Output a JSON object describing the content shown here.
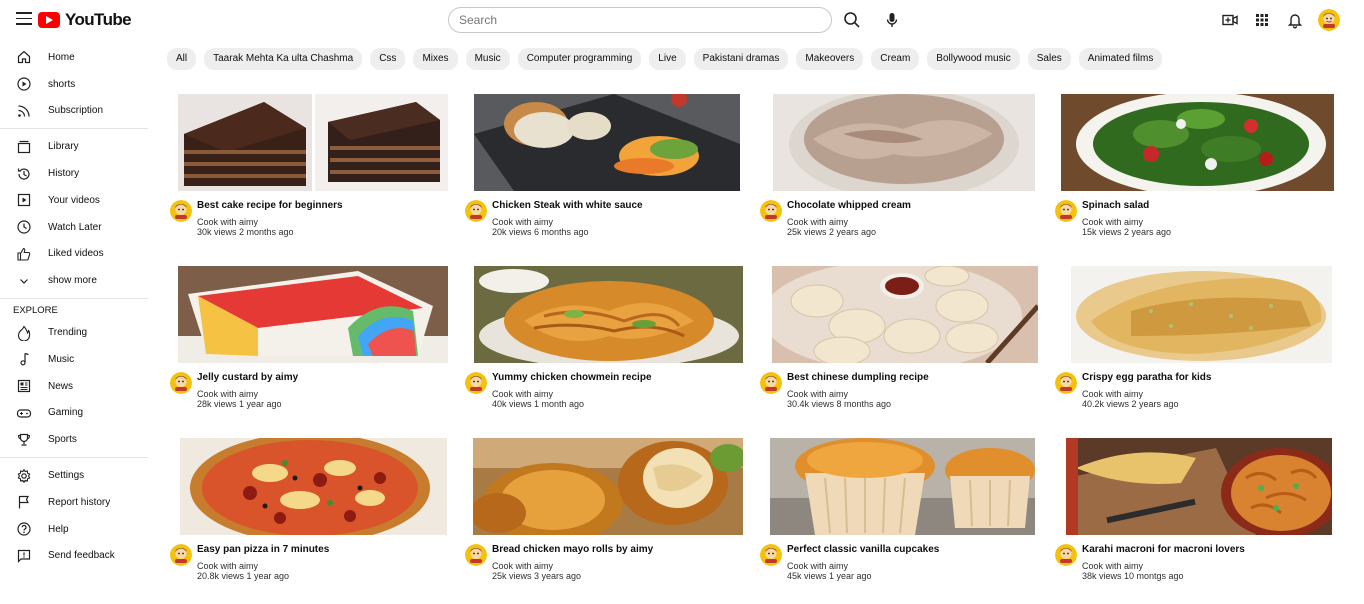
{
  "header": {
    "logo_text": "YouTube",
    "search_placeholder": "Search"
  },
  "sidebar": {
    "main": [
      {
        "label": "Home",
        "icon": "home-icon"
      },
      {
        "label": "shorts",
        "icon": "shorts-icon"
      },
      {
        "label": "Subscription",
        "icon": "subscription-icon"
      }
    ],
    "library": [
      {
        "label": "Library",
        "icon": "library-icon"
      },
      {
        "label": "History",
        "icon": "history-icon"
      },
      {
        "label": "Your videos",
        "icon": "your-videos-icon"
      },
      {
        "label": "Watch Later",
        "icon": "watch-later-icon"
      },
      {
        "label": "Liked videos",
        "icon": "liked-icon"
      },
      {
        "label": "show more",
        "icon": "chevron-down-icon"
      }
    ],
    "explore_heading": "EXPLORE",
    "explore": [
      {
        "label": "Trending",
        "icon": "trending-icon"
      },
      {
        "label": "Music",
        "icon": "music-icon"
      },
      {
        "label": "News",
        "icon": "news-icon"
      },
      {
        "label": "Gaming",
        "icon": "gaming-icon"
      },
      {
        "label": "Sports",
        "icon": "sports-icon"
      }
    ],
    "footer": [
      {
        "label": "Settings",
        "icon": "settings-icon"
      },
      {
        "label": "Report history",
        "icon": "flag-icon"
      },
      {
        "label": "Help",
        "icon": "help-icon"
      },
      {
        "label": "Send feedback",
        "icon": "feedback-icon"
      }
    ]
  },
  "chips": [
    "All",
    "Taarak Mehta Ka ulta Chashma",
    "Css",
    "Mixes",
    "Music",
    "Computer programming",
    "Live",
    "Pakistani dramas",
    "Makeovers",
    "Cream",
    "Bollywood music",
    "Sales",
    "Animated films"
  ],
  "videos": [
    {
      "title": "Best cake recipe for beginners",
      "channel": "Cook with aimy",
      "meta": "30k views 2 months ago"
    },
    {
      "title": "Chicken Steak with white sauce",
      "channel": "Cook with aimy",
      "meta": "20k views 6 months ago"
    },
    {
      "title": "Chocolate whipped cream",
      "channel": "Cook with aimy",
      "meta": "25k views 2 years ago"
    },
    {
      "title": "Spinach salad",
      "channel": "Cook with aimy",
      "meta": "15k views 2 years ago"
    },
    {
      "title": "Jelly custard by aimy",
      "channel": "Cook with aimy",
      "meta": "28k views 1 year ago"
    },
    {
      "title": "Yummy chicken chowmein recipe",
      "channel": "Cook with aimy",
      "meta": "40k views 1 month ago"
    },
    {
      "title": "Best chinese dumpling recipe",
      "channel": "Cook with aimy",
      "meta": "30.4k views 8 months ago"
    },
    {
      "title": "Crispy egg paratha for kids",
      "channel": "Cook with aimy",
      "meta": "40.2k views 2 years ago"
    },
    {
      "title": "Easy pan pizza in 7 minutes",
      "channel": "Cook with aimy",
      "meta": "20.8k views 1 year ago"
    },
    {
      "title": "Bread chicken mayo rolls by aimy",
      "channel": "Cook with aimy",
      "meta": "25k views 3 years ago"
    },
    {
      "title": "Perfect classic vanilla cupcakes",
      "channel": "Cook with aimy",
      "meta": "45k views 1 year ago"
    },
    {
      "title": "Karahi macroni for macroni lovers",
      "channel": "Cook with aimy",
      "meta": "38k views 10 montgs ago"
    }
  ]
}
